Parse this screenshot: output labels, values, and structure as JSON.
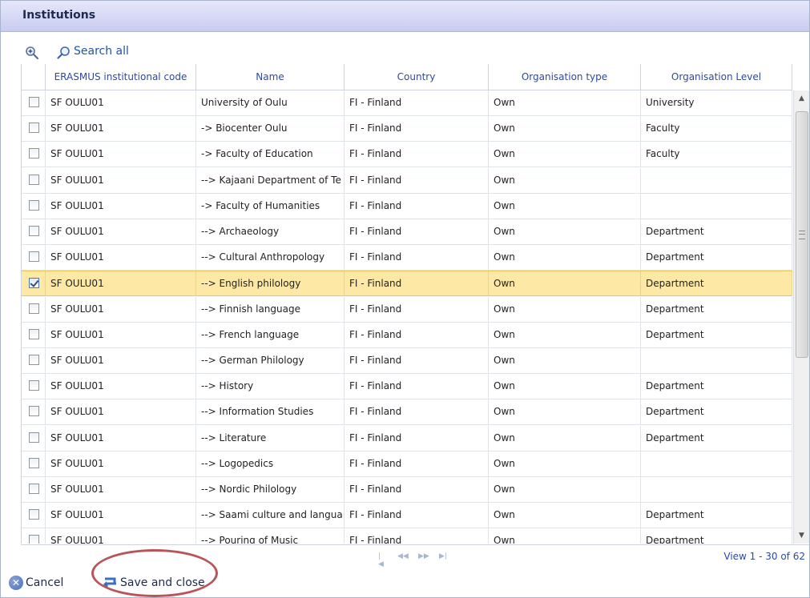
{
  "window": {
    "title": "Institutions"
  },
  "toolbar": {
    "search_all_label": "Search all"
  },
  "columns": [
    "ERASMUS institutional code",
    "Name",
    "Country",
    "Organisation type",
    "Organisation Level"
  ],
  "rows": [
    {
      "code": "SF OULU01",
      "name": "University of Oulu",
      "country": "FI - Finland",
      "type": "Own",
      "level": "University",
      "checked": false
    },
    {
      "code": "SF OULU01",
      "name": "-> Biocenter Oulu",
      "country": "FI - Finland",
      "type": "Own",
      "level": "Faculty",
      "checked": false
    },
    {
      "code": "SF OULU01",
      "name": "-> Faculty of Education",
      "country": "FI - Finland",
      "type": "Own",
      "level": "Faculty",
      "checked": false
    },
    {
      "code": "SF OULU01",
      "name": "--> Kajaani Department of Te",
      "country": "FI - Finland",
      "type": "Own",
      "level": "",
      "checked": false
    },
    {
      "code": "SF OULU01",
      "name": "-> Faculty of Humanities",
      "country": "FI - Finland",
      "type": "Own",
      "level": "",
      "checked": false
    },
    {
      "code": "SF OULU01",
      "name": "--> Archaeology",
      "country": "FI - Finland",
      "type": "Own",
      "level": "Department",
      "checked": false
    },
    {
      "code": "SF OULU01",
      "name": "--> Cultural Anthropology",
      "country": "FI - Finland",
      "type": "Own",
      "level": "Department",
      "checked": false
    },
    {
      "code": "SF OULU01",
      "name": "--> English philology",
      "country": "FI - Finland",
      "type": "Own",
      "level": "Department",
      "checked": true
    },
    {
      "code": "SF OULU01",
      "name": "--> Finnish language",
      "country": "FI - Finland",
      "type": "Own",
      "level": "Department",
      "checked": false
    },
    {
      "code": "SF OULU01",
      "name": "--> French language",
      "country": "FI - Finland",
      "type": "Own",
      "level": "Department",
      "checked": false
    },
    {
      "code": "SF OULU01",
      "name": "--> German Philology",
      "country": "FI - Finland",
      "type": "Own",
      "level": "",
      "checked": false
    },
    {
      "code": "SF OULU01",
      "name": "--> History",
      "country": "FI - Finland",
      "type": "Own",
      "level": "Department",
      "checked": false
    },
    {
      "code": "SF OULU01",
      "name": "--> Information Studies",
      "country": "FI - Finland",
      "type": "Own",
      "level": "Department",
      "checked": false
    },
    {
      "code": "SF OULU01",
      "name": "--> Literature",
      "country": "FI - Finland",
      "type": "Own",
      "level": "Department",
      "checked": false
    },
    {
      "code": "SF OULU01",
      "name": "--> Logopedics",
      "country": "FI - Finland",
      "type": "Own",
      "level": "",
      "checked": false
    },
    {
      "code": "SF OULU01",
      "name": "--> Nordic Philology",
      "country": "FI - Finland",
      "type": "Own",
      "level": "",
      "checked": false
    },
    {
      "code": "SF OULU01",
      "name": "--> Saami culture and langua",
      "country": "FI - Finland",
      "type": "Own",
      "level": "Department",
      "checked": false
    },
    {
      "code": "SF OULU01",
      "name": "--> Pouring of Music",
      "country": "FI - Finland",
      "type": "Own",
      "level": "Department",
      "checked": false
    }
  ],
  "pager": {
    "first": "|◀",
    "prev": "◀◀",
    "next": "▶▶",
    "last": "▶|",
    "view_range": "View 1 - 30 of 62"
  },
  "footer": {
    "cancel_label": "Cancel",
    "save_label": "Save and close"
  },
  "colors": {
    "selected_row": "#fde9a5",
    "header_text": "#2b4aa3",
    "highlight_ellipse": "#b8545a"
  },
  "icons": {
    "zoom": "zoom-in-icon",
    "search": "search-icon",
    "cancel": "cancel-icon",
    "save": "save-icon"
  }
}
